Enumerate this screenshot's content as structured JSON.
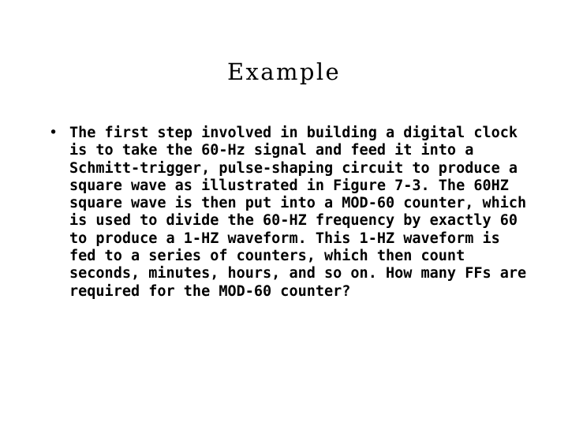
{
  "slide": {
    "background_color": "#ffffff",
    "text_color": "#000000",
    "title": "Example",
    "bullets": [
      {
        "marker": "•",
        "lines": [
          "The first step involved in building a digital clock",
          "is to take the 60-Hz signal and feed it into a",
          "Schmitt-trigger, pulse-shaping circuit to produce a",
          "square wave as illustrated in Figure 7-3. The 60HZ",
          "square wave is then put into a MOD-60 counter, which",
          "is used to divide the 60-HZ frequency by exactly 60",
          "to produce a 1-HZ waveform. This 1-HZ waveform is",
          "fed to a series of counters, which then count",
          "seconds, minutes, hours, and so on. How many FFs are",
          "required for the MOD-60 counter?"
        ],
        "text": "The first step involved in building a digital clock\nis to take the 60-Hz signal and feed it into a\nSchmitt-trigger, pulse-shaping circuit to produce a\nsquare wave as illustrated in Figure 7-3. The 60HZ\nsquare wave is then put into a MOD-60 counter, which\nis used to divide the 60-HZ frequency by exactly 60\nto produce a 1-HZ waveform. This 1-HZ waveform is\nfed to a series of counters, which then count\nseconds, minutes, hours, and so on. How many FFs are\nrequired for the MOD-60 counter?"
      }
    ]
  }
}
